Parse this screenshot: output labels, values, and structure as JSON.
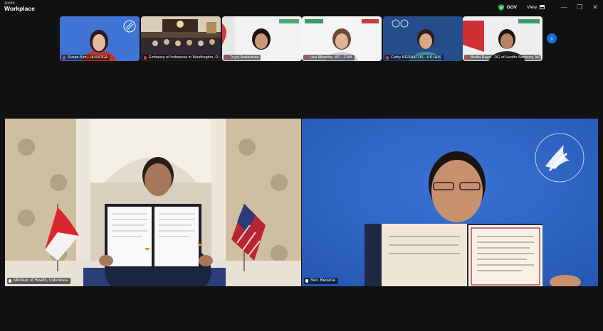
{
  "app": {
    "brand_line1": "zoom",
    "brand_line2": "Workplace"
  },
  "titlebar": {
    "gov_label": "GOV",
    "view_label": "View",
    "minimize": "—",
    "restore": "❐",
    "close": "✕"
  },
  "gallery": {
    "tiles": [
      {
        "name": "Susan Kim | HHS/OGA"
      },
      {
        "name": "Embassy of Indonesia in Washington, D..."
      },
      {
        "name": "Tuyoi Andalzuda"
      },
      {
        "name": "Lisa Miranda, MD | CMA"
      },
      {
        "name": "Cathy BERNATOS - US HHS"
      },
      {
        "name": "Budhi Raya - DG of Health Services, MOH"
      }
    ],
    "next_icon": "›"
  },
  "speakers": {
    "left": {
      "name": "Minister of Health, Indonesia"
    },
    "right": {
      "name": "Sec. Becerra"
    }
  },
  "colors": {
    "background": "#111111",
    "accent": "#1a6fe0",
    "muted_mic": "#e23c3c"
  }
}
